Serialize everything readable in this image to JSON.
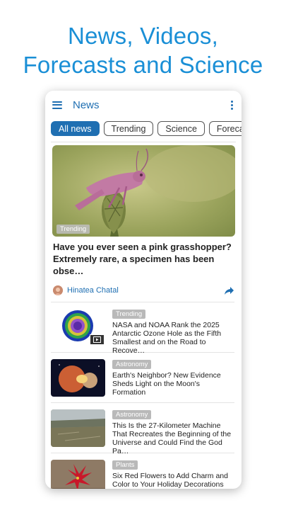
{
  "headline": {
    "line1": "News, Videos,",
    "line2": "Forecasts and Science"
  },
  "appbar": {
    "title": "News",
    "menu_icon": "hamburger-menu-icon",
    "overflow_icon": "more-vert-icon"
  },
  "chips": [
    "All news",
    "Trending",
    "Science",
    "Forecast"
  ],
  "hero": {
    "badge": "Trending",
    "title": "Have you ever seen a pink grasshopper? Extremely rare, a specimen has been obse…",
    "author": "Hinatea Chatal",
    "share_icon": "share-icon"
  },
  "items": [
    {
      "badge": "Trending",
      "title": "NASA and NOAA Rank the 2025 Antarctic Ozone Hole as the Fifth Smallest and on the Road to Recove…",
      "has_video": true
    },
    {
      "badge": "Astronomy",
      "title": "Earth's Neighbor? New Evidence Sheds Light on the Moon's Formation",
      "has_video": false
    },
    {
      "badge": "Astronomy",
      "title": "This Is the 27-Kilometer Machine That Recreates the Beginning of the Universe and Could Find the God Pa…",
      "has_video": false
    },
    {
      "badge": "Plants",
      "title": "Six Red Flowers to Add Charm and Color to Your Holiday Decorations",
      "has_video": false
    }
  ],
  "colors": {
    "accent": "#1f6fb2",
    "headline": "#1a8fd6",
    "badge": "#b9b9b9"
  }
}
